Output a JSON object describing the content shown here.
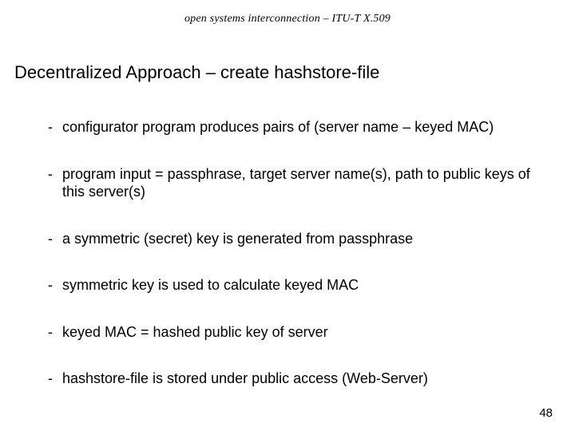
{
  "header": "open systems interconnection – ITU-T X.509",
  "title": "Decentralized Approach – create hashstore-file",
  "bullets": [
    "configurator program produces pairs of (server name – keyed MAC)",
    "program input = passphrase, target server name(s), path to public keys of this server(s)",
    "a symmetric (secret) key is generated from passphrase",
    "symmetric key is used to calculate keyed MAC",
    "keyed MAC = hashed public key of server",
    "hashstore-file is stored under public access (Web-Server)"
  ],
  "dash": "-",
  "pageNumber": "48"
}
